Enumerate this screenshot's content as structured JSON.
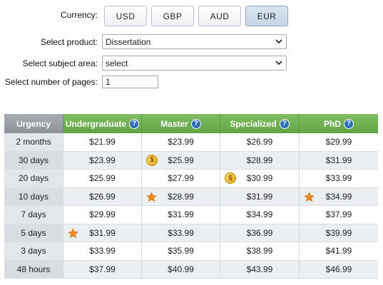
{
  "form": {
    "currency_label": "Currency:",
    "currencies": [
      "USD",
      "GBP",
      "AUD",
      "EUR"
    ],
    "selected_currency": "EUR",
    "product_label": "Select product:",
    "product_value": "Dissertation",
    "subject_label": "Select subject area:",
    "subject_value": "select",
    "pages_label": "Select number of pages:",
    "pages_value": "1"
  },
  "table": {
    "headers": [
      "Urgency",
      "Undergraduate",
      "Master",
      "Specialized",
      "PhD"
    ],
    "rows": [
      {
        "urgency": "2 months",
        "prices": [
          "$21.99",
          "$23.99",
          "$26.99",
          "$29.99"
        ]
      },
      {
        "urgency": "30 days",
        "prices": [
          "$23.99",
          "$25.99",
          "$28.99",
          "$31.99"
        ]
      },
      {
        "urgency": "20 days",
        "prices": [
          "$25.99",
          "$27.99",
          "$30.99",
          "$33.99"
        ]
      },
      {
        "urgency": "10 days",
        "prices": [
          "$26.99",
          "$28.99",
          "$31.99",
          "$34.99"
        ]
      },
      {
        "urgency": "7 days",
        "prices": [
          "$29.99",
          "$31.99",
          "$34.99",
          "$37.99"
        ]
      },
      {
        "urgency": "5 days",
        "prices": [
          "$31.99",
          "$33.99",
          "$36.99",
          "$39.99"
        ]
      },
      {
        "urgency": "3 days",
        "prices": [
          "$33.99",
          "$35.99",
          "$38.99",
          "$41.99"
        ]
      },
      {
        "urgency": "48 hours",
        "prices": [
          "$37.99",
          "$40.99",
          "$43.99",
          "$46.99"
        ]
      }
    ],
    "badges": {
      "coin": [
        [
          1,
          1
        ],
        [
          2,
          2
        ]
      ],
      "star": [
        [
          3,
          1
        ],
        [
          3,
          3
        ],
        [
          5,
          0
        ]
      ]
    },
    "colors": {
      "header_green": "#6aad4c",
      "header_gray": "#9aa0a6",
      "help_blue": "#2f6fb8",
      "star_orange": "#f08a1c",
      "coin_gold": "#f0b400"
    }
  }
}
